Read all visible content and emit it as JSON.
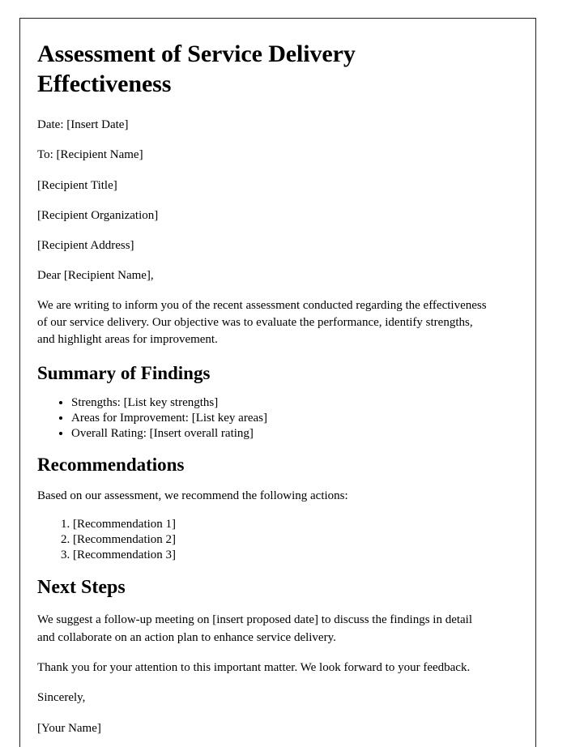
{
  "document": {
    "title": "Assessment of Service Delivery Effectiveness",
    "meta": [
      "Date: [Insert Date]",
      "To: [Recipient Name]",
      "[Recipient Title]",
      "[Recipient Organization]",
      "[Recipient Address]"
    ],
    "salutation": "Dear [Recipient Name],",
    "intro_paragraph": "We are writing to inform you of the recent assessment conducted regarding the effectiveness of our service delivery. Our objective was to evaluate the performance, identify strengths, and highlight areas for improvement.",
    "sections": {
      "summary": {
        "heading": "Summary of Findings",
        "items": [
          "Strengths: [List key strengths]",
          "Areas for Improvement: [List key areas]",
          "Overall Rating: [Insert overall rating]"
        ]
      },
      "recommendations": {
        "heading": "Recommendations",
        "lead_in": "Based on our assessment, we recommend the following actions:",
        "items": [
          "[Recommendation 1]",
          "[Recommendation 2]",
          "[Recommendation 3]"
        ]
      },
      "next_steps": {
        "heading": "Next Steps",
        "paragraph": "We suggest a follow-up meeting on [insert proposed date] to discuss the findings in detail and collaborate on an action plan to enhance service delivery.",
        "thanks": "Thank you for your attention to this important matter. We look forward to your feedback."
      }
    },
    "closing": {
      "sign_off": "Sincerely,",
      "signature_name": "[Your Name]"
    }
  }
}
